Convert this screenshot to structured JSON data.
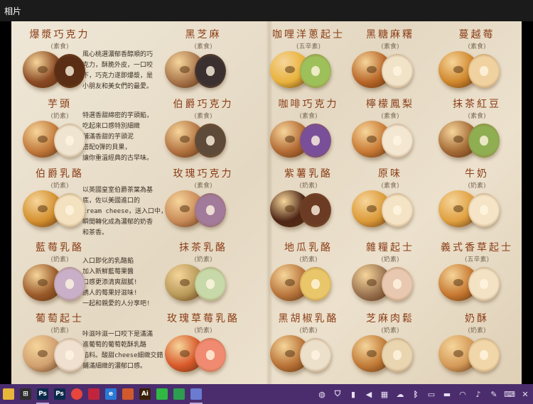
{
  "window": {
    "title": "相片"
  },
  "menu": {
    "items": [
      {
        "name": "爆漿巧克力",
        "tag": "(素食)",
        "color": "#8a4a24",
        "cut": "#5a2e14"
      },
      {
        "name": "黑芝麻",
        "tag": "(素食)",
        "color": "#a8744a",
        "cut": "#3b3030"
      },
      {
        "name": "咖哩洋蔥起士",
        "tag": "(五辛素)",
        "color": "#e8b23c",
        "cut": "#9ec05a"
      },
      {
        "name": "黑糖麻糬",
        "tag": "(素食)",
        "color": "#b86628",
        "cut": "#f1e3c8"
      },
      {
        "name": "蔓越莓",
        "tag": "(素食)",
        "color": "#d0872c",
        "cut": "#f0d2a0"
      },
      {
        "name": "芋頭",
        "tag": "(奶素)",
        "color": "#c1783a",
        "cut": "#efe4cf"
      },
      {
        "name": "伯爵巧克力",
        "tag": "(素食)",
        "color": "#b27240",
        "cut": "#5e4a38"
      },
      {
        "name": "咖啡巧克力",
        "tag": "(素食)",
        "color": "#b36a34",
        "cut": "#7a4f9a"
      },
      {
        "name": "檸檬鳳梨",
        "tag": "(素食)",
        "color": "#c87a34",
        "cut": "#f4e7d2"
      },
      {
        "name": "抹茶紅豆",
        "tag": "(素食)",
        "color": "#a46a36",
        "cut": "#8fae52"
      },
      {
        "name": "伯爵乳酪",
        "tag": "(奶素)",
        "color": "#d4902e",
        "cut": "#f3e1bf"
      },
      {
        "name": "玫瑰巧克力",
        "tag": "(素食)",
        "color": "#c98a58",
        "cut": "#a27a9a"
      },
      {
        "name": "紫薯乳酪",
        "tag": "(奶素)",
        "color": "#4e2616",
        "cut": "#6b3b24"
      },
      {
        "name": "原味",
        "tag": "(素食)",
        "color": "#dc9a38",
        "cut": "#f4e3c4"
      },
      {
        "name": "牛奶",
        "tag": "(奶素)",
        "color": "#e0a040",
        "cut": "#f5e4c6"
      },
      {
        "name": "藍莓乳酪",
        "tag": "(奶素)",
        "color": "#9a5a2a",
        "cut": "#c9b0c8"
      },
      {
        "name": "抹茶乳酪",
        "tag": "(奶素)",
        "color": "#b89a5a",
        "cut": "#c7d9a8"
      },
      {
        "name": "地瓜乳酪",
        "tag": "(奶素)",
        "color": "#b9763c",
        "cut": "#e9c66a"
      },
      {
        "name": "雜糧起士",
        "tag": "(奶素)",
        "color": "#9a7250",
        "cut": "#e8c8b0"
      },
      {
        "name": "義式香草起士",
        "tag": "(五辛素)",
        "color": "#c67830",
        "cut": "#f3e2c4"
      },
      {
        "name": "葡萄起士",
        "tag": "(奶素)",
        "color": "#d1a070",
        "cut": "#efe0d0"
      },
      {
        "name": "玫瑰草莓乳酪",
        "tag": "(奶素)",
        "color": "#d8582a",
        "cut": "#f08a70"
      },
      {
        "name": "黑胡椒乳酪",
        "tag": "(奶素)",
        "color": "#b87236",
        "cut": "#ede0ca"
      },
      {
        "name": "芝麻肉鬆",
        "tag": "(奶素)",
        "color": "#c07a36",
        "cut": "#e9d5b0"
      },
      {
        "name": "奶酥",
        "tag": "(奶素)",
        "color": "#d49a58",
        "cut": "#f0d6a8"
      }
    ],
    "descriptions": [
      "風心桃選濃郁香醇順的巧\n克力，酥脆外皮，一口咬\n下，巧克力遂即爆漿，是\n小朋友和美女們的最愛。",
      "特選香甜綿密的芋頭餡，\n吃起來口感特別細緻\n鋪滿香甜的芋頭泥\n搭配Q彈的貝果，\n讓你重溫經典的古早味。",
      "以英國皇室伯爵茶葉為基\n底，佐以美國進口的\ncream cheese，送入口中，\n瞬間轉化成為濃郁的奶香\n和茶香。",
      "入口即化的乳酪餡\n加入新鮮藍莓果醬\n口感更添清爽甜膩!\n誘人的莓果好滋味!\n一起和親愛的人分享吧!",
      "咔滋咔滋一口咬下是滿滿\n進葡萄的葡萄乾酥乳酪\n餡料。酸甜cheese細緻交錯\n鋪滿細緻的濃郁口感。"
    ]
  },
  "taskbar": {
    "apps": [
      {
        "icon": "file-explorer-icon",
        "glyph": "",
        "bg": "#e8b73a"
      },
      {
        "icon": "store-icon",
        "glyph": "⊞",
        "bg": "#2d2d2d"
      },
      {
        "icon": "photoshop-icon",
        "glyph": "Ps",
        "bg": "#0b2a4a",
        "active": true
      },
      {
        "icon": "photoshop-icon-2",
        "glyph": "Ps",
        "bg": "#0b2a4a"
      },
      {
        "icon": "chrome-icon",
        "glyph": "",
        "bg": "#e8453c"
      },
      {
        "icon": "antivirus-icon",
        "glyph": "",
        "bg": "#c0253d"
      },
      {
        "icon": "internet-explorer-icon",
        "glyph": "e",
        "bg": "#2a7ad6"
      },
      {
        "icon": "powerpoint-icon",
        "glyph": "",
        "bg": "#d05a2c"
      },
      {
        "icon": "illustrator-icon",
        "glyph": "Ai",
        "bg": "#3a1f07"
      },
      {
        "icon": "line-icon",
        "glyph": "",
        "bg": "#2fb842"
      },
      {
        "icon": "contacts-icon",
        "glyph": "",
        "bg": "#2d9d4f"
      },
      {
        "icon": "photos-icon",
        "glyph": "",
        "bg": "#6a7bd0",
        "active": true
      }
    ],
    "tray": [
      "wechat-icon",
      "shield-icon",
      "usb-icon",
      "volume-icon",
      "network-icon",
      "cloud-icon",
      "bluetooth-icon",
      "display-icon",
      "battery-icon",
      "wifi-icon",
      "speaker-icon",
      "pen-icon",
      "keyboard-icon",
      "close-notification-icon"
    ]
  }
}
